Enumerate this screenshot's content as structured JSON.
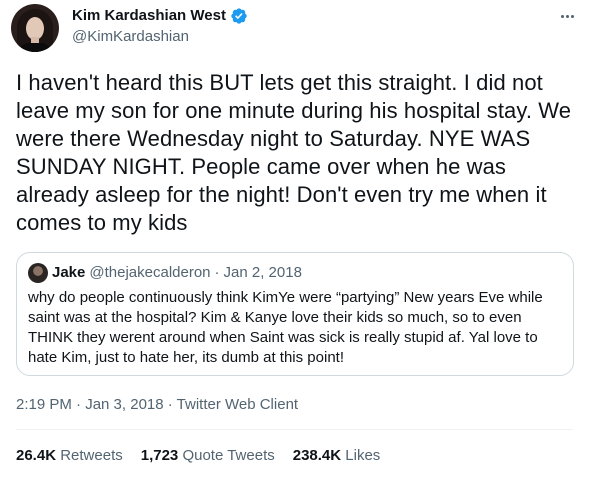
{
  "author": {
    "display_name": "Kim Kardashian West",
    "handle": "@KimKardashian"
  },
  "tweet_text": "I haven't heard this BUT lets get this straight. I did not leave my son for one minute during his hospital stay. We were there Wednesday night to Saturday. NYE WAS SUNDAY NIGHT. People came over when he was already asleep for the night! Don't even try me when it comes to my kids",
  "quote": {
    "name": "Jake",
    "handle": "@thejakecalderon",
    "separator": "·",
    "date": "Jan 2, 2018",
    "text": "why do people continuously think KimYe were “partying” New years Eve while saint was at the hospital? Kim & Kanye love their kids so much, so to even THINK they werent around when Saint was sick is really stupid af. Yal love to hate Kim, just to hate her, its dumb at this point!"
  },
  "timestamp": "2:19 PM · Jan 3, 2018 · Twitter Web Client",
  "stats": {
    "retweets_count": "26.4K",
    "retweets_label": "Retweets",
    "quote_count": "1,723",
    "quote_label": "Quote Tweets",
    "likes_count": "238.4K",
    "likes_label": "Likes"
  },
  "icons": {
    "verified": "verified-badge-icon",
    "more": "more-options-icon"
  },
  "colors": {
    "verified_blue": "#1d9bf0",
    "secondary_text": "#536471",
    "border": "#cfd9de"
  }
}
